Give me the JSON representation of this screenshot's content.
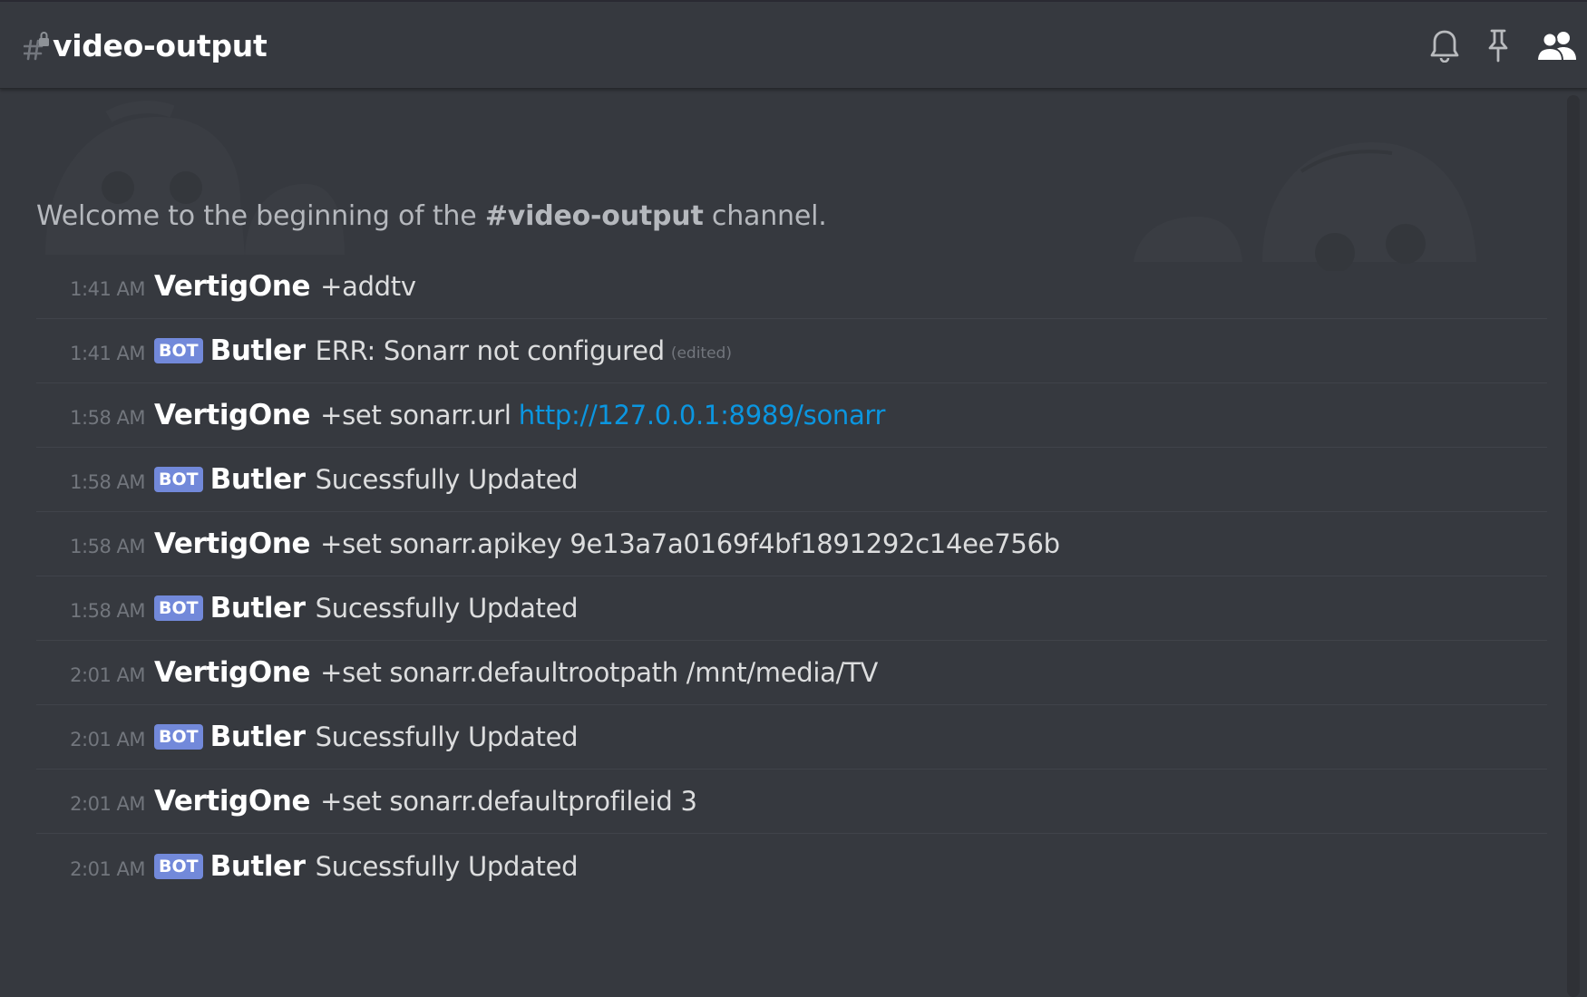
{
  "header": {
    "channel_name": "video-output",
    "icons": [
      "hash-lock-icon",
      "bell-icon",
      "pin-icon",
      "members-icon"
    ]
  },
  "welcome": {
    "prefix": "Welcome to the beginning of the ",
    "channel": "#video-output",
    "suffix": " channel."
  },
  "colors": {
    "background": "#36393f",
    "bot_tag": "#7289da",
    "link": "#0b96e0",
    "timestamp": "#72767d"
  },
  "messages": [
    {
      "time": "1:41 AM",
      "author": "VertigOne",
      "bot": false,
      "text": "+addtv"
    },
    {
      "time": "1:41 AM",
      "author": "Butler",
      "bot": true,
      "bot_label": "BOT",
      "text": "ERR: Sonarr not configured",
      "edited": "(edited)"
    },
    {
      "time": "1:58 AM",
      "author": "VertigOne",
      "bot": false,
      "text": "+set sonarr.url",
      "link": "http://127.0.0.1:8989/sonarr"
    },
    {
      "time": "1:58 AM",
      "author": "Butler",
      "bot": true,
      "bot_label": "BOT",
      "text": "Sucessfully Updated"
    },
    {
      "time": "1:58 AM",
      "author": "VertigOne",
      "bot": false,
      "text": "+set sonarr.apikey 9e13a7a0169f4bf1891292c14ee756b"
    },
    {
      "time": "1:58 AM",
      "author": "Butler",
      "bot": true,
      "bot_label": "BOT",
      "text": "Sucessfully Updated"
    },
    {
      "time": "2:01 AM",
      "author": "VertigOne",
      "bot": false,
      "text": "+set sonarr.defaultrootpath /mnt/media/TV"
    },
    {
      "time": "2:01 AM",
      "author": "Butler",
      "bot": true,
      "bot_label": "BOT",
      "text": "Sucessfully Updated"
    },
    {
      "time": "2:01 AM",
      "author": "VertigOne",
      "bot": false,
      "text": "+set sonarr.defaultprofileid 3"
    },
    {
      "time": "2:01 AM",
      "author": "Butler",
      "bot": true,
      "bot_label": "BOT",
      "text": "Sucessfully Updated"
    }
  ]
}
